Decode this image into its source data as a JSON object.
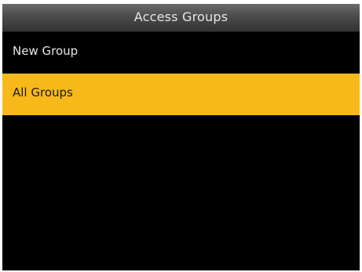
{
  "header": {
    "title": "Access Groups"
  },
  "menu": {
    "items": [
      {
        "label": "New Group",
        "selected": false
      },
      {
        "label": "All Groups",
        "selected": true
      }
    ]
  },
  "colors": {
    "highlight": "#f7b91a",
    "background": "#000000",
    "text": "#e6e6e6"
  }
}
